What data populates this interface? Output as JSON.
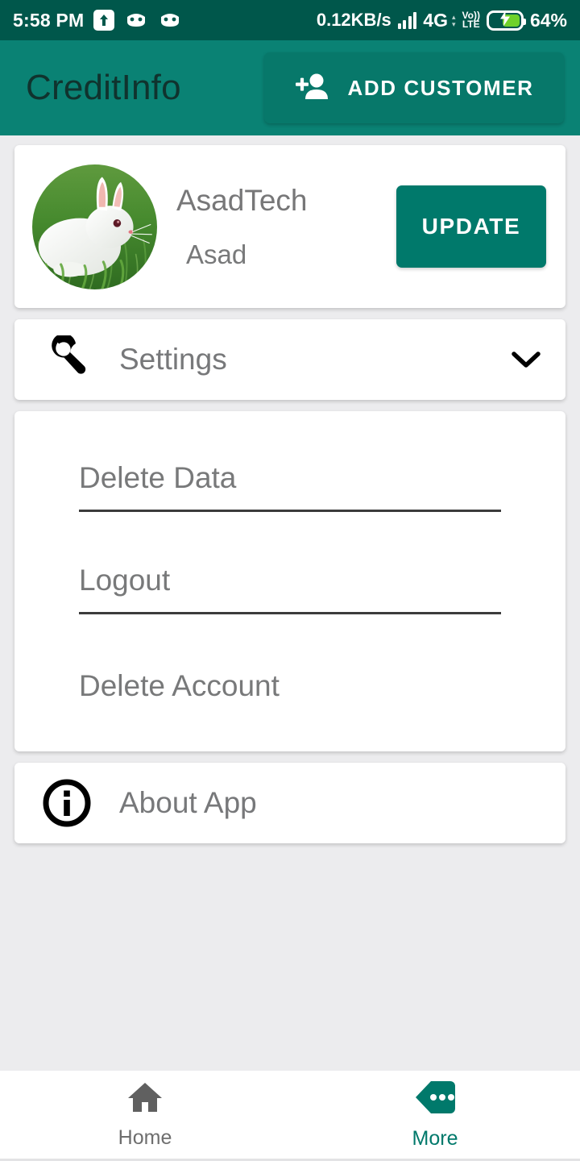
{
  "status_bar": {
    "time": "5:58 PM",
    "network_speed": "0.12KB/s",
    "network_type": "4G",
    "volte_top": "Vo))",
    "volte_bottom": "LTE",
    "battery_percent": "64%",
    "icons": [
      "upload-icon",
      "android-head-icon",
      "android-head-icon",
      "signal-icon",
      "volte-icon",
      "battery-charging-icon"
    ],
    "background_color": "#00574b"
  },
  "app_bar": {
    "title": "CreditInfo",
    "add_customer_label": "ADD CUSTOMER",
    "background_color": "#0a8274",
    "button_color": "#07786a"
  },
  "profile": {
    "name": "AsadTech",
    "subtitle": "Asad",
    "update_label": "UPDATE",
    "avatar_alt": "white-rabbit-on-grass",
    "update_color": "#00796b"
  },
  "settings": {
    "label": "Settings",
    "icon": "wrench-icon",
    "expand_icon": "chevron-down-icon",
    "expanded": true,
    "items": [
      {
        "label": "Delete Data",
        "divider": true
      },
      {
        "label": "Logout",
        "divider": true
      },
      {
        "label": "Delete Account",
        "divider": false
      }
    ]
  },
  "about": {
    "label": "About App",
    "icon": "info-icon"
  },
  "bottom_nav": {
    "items": [
      {
        "label": "Home",
        "icon": "home-icon",
        "active": false
      },
      {
        "label": "More",
        "icon": "more-tag-icon",
        "active": true
      }
    ],
    "active_color": "#00796b",
    "inactive_color": "#6e6e6e"
  }
}
